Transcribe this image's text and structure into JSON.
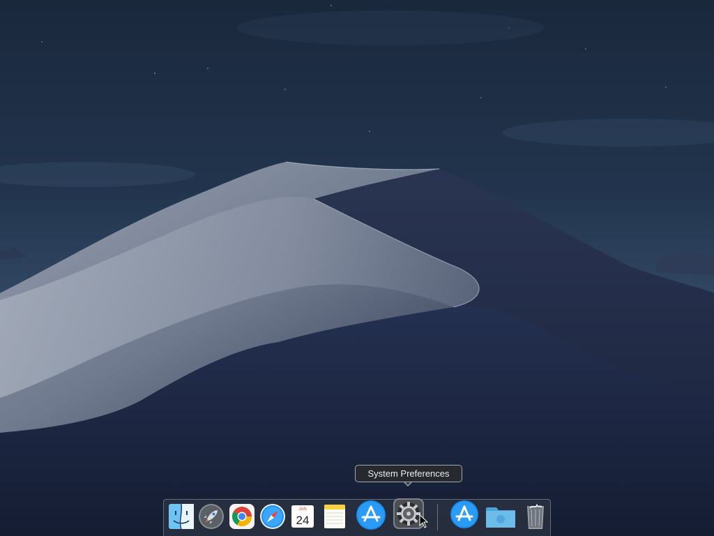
{
  "desktop": {
    "wallpaper": "macOS Mojave night dunes",
    "colors": {
      "sky_top": "#1b2a3e",
      "sky_horizon": "#3d5572",
      "dune_light": "#8e98a8",
      "dune_shadow": "#1e2840"
    }
  },
  "tooltip": {
    "text": "System Preferences"
  },
  "dock": {
    "apps": [
      {
        "name": "Finder",
        "icon": "finder-icon"
      },
      {
        "name": "Launchpad",
        "icon": "launchpad-rocket-icon"
      },
      {
        "name": "Google Chrome",
        "icon": "chrome-icon"
      },
      {
        "name": "Safari",
        "icon": "safari-compass-icon"
      },
      {
        "name": "Calendar",
        "icon": "calendar-icon",
        "month": "JAN",
        "day": "24"
      },
      {
        "name": "Notes",
        "icon": "notes-icon"
      },
      {
        "name": "App Store",
        "icon": "app-store-icon"
      },
      {
        "name": "System Preferences",
        "icon": "gear-icon"
      }
    ],
    "others": [
      {
        "name": "App Store download",
        "icon": "app-store-icon"
      },
      {
        "name": "Downloads folder",
        "icon": "folder-icon"
      },
      {
        "name": "Trash",
        "icon": "trash-icon"
      }
    ]
  }
}
